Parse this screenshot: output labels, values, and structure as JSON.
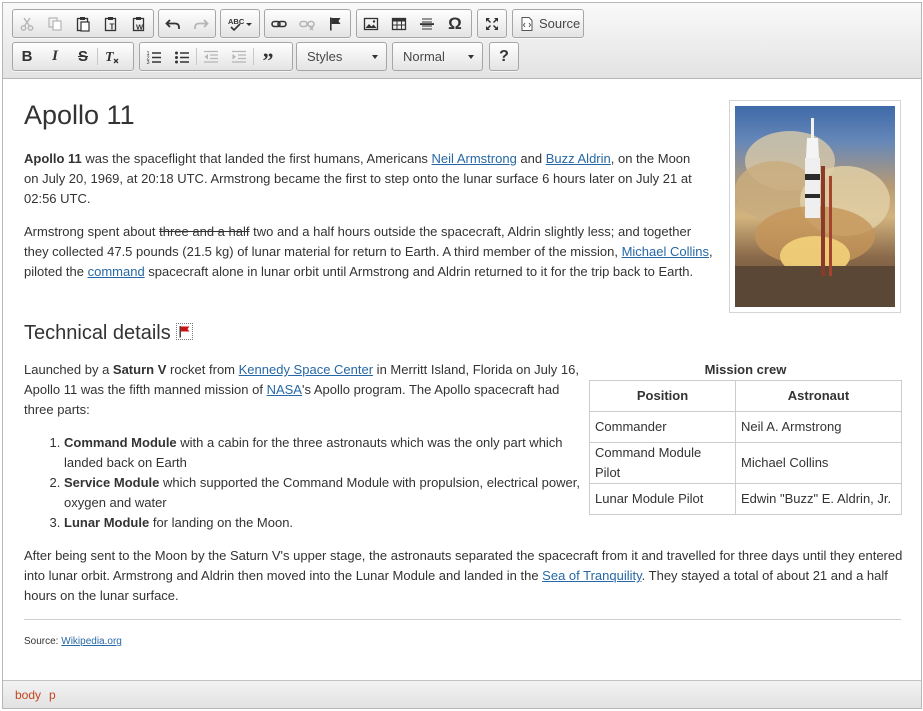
{
  "toolbar": {
    "row1": {
      "clipboard": [
        "cut-icon",
        "copy-icon",
        "paste-icon",
        "paste-text-icon",
        "paste-word-icon"
      ],
      "undo": [
        "undo-icon",
        "redo-icon"
      ],
      "spell": "spellcheck-icon",
      "links": [
        "link-icon",
        "unlink-icon",
        "anchor-icon"
      ],
      "insert": [
        "image-icon",
        "table-icon",
        "horizontal-rule-icon",
        "special-char-icon"
      ],
      "maximize": "maximize-icon",
      "source_label": "Source"
    },
    "row2": {
      "basic": [
        "bold-icon",
        "italic-icon",
        "strike-icon",
        "remove-format-icon"
      ],
      "lists": [
        "numbered-list-icon",
        "bulleted-list-icon",
        "outdent-icon",
        "indent-icon",
        "blockquote-icon"
      ],
      "styles_combo": "Styles",
      "format_combo": "Normal",
      "help_label": "?"
    }
  },
  "content": {
    "title": "Apollo 11",
    "p1": {
      "b1": "Apollo 11",
      "t1": " was the spaceflight that landed the first humans, Americans ",
      "l1": "Neil Armstrong",
      "t2": " and ",
      "l2": "Buzz Aldrin",
      "t3": ", on the Moon on July 20, 1969, at 20:18 UTC. Armstrong became the first to step onto the lunar surface 6 hours later on July 21 at 02:56 UTC."
    },
    "p2": {
      "t1": "Armstrong spent about ",
      "strike": "three and a half",
      "t2": " two and a half hours outside the spacecraft, Aldrin slightly less; and together they collected 47.5 pounds (21.5 kg) of lunar material for return to Earth. A third member of the mission, ",
      "l1": "Michael Collins",
      "t3": ", piloted the ",
      "l2": "command",
      "t4": " spacecraft alone in lunar orbit until Armstrong and Aldrin returned to it for the trip back to Earth."
    },
    "subtitle": "Technical details",
    "p3": {
      "t1": "Launched by a ",
      "b1": "Saturn V",
      "t2": " rocket from ",
      "l1": "Kennedy Space Center",
      "t3": " in Merritt Island, Florida on July 16, Apollo 11 was the fifth manned mission of ",
      "l2": "NASA",
      "t4": "'s Apollo program. The Apollo spacecraft had three parts:"
    },
    "parts": [
      {
        "b": "Command Module",
        "t": " with a cabin for the three astronauts which was the only part which landed back on Earth"
      },
      {
        "b": "Service Module",
        "t": " which supported the Command Module with propulsion, electrical power, oxygen and water"
      },
      {
        "b": "Lunar Module",
        "t": " for landing on the Moon."
      }
    ],
    "p4": {
      "t1": "After being sent to the Moon by the Saturn V's upper stage, the astronauts separated the spacecraft from it and travelled for three days until they entered into lunar orbit. Armstrong and Aldrin then moved into the Lunar Module and landed in the ",
      "l1": "Sea of Tranquility",
      "t2": ". They stayed a total of about 21 and a half hours on the lunar surface."
    },
    "crew": {
      "caption": "Mission crew",
      "headers": [
        "Position",
        "Astronaut"
      ],
      "rows": [
        [
          "Commander",
          "Neil A. Armstrong"
        ],
        [
          "Command Module Pilot",
          "Michael Collins"
        ],
        [
          "Lunar Module Pilot",
          "Edwin \"Buzz\" E. Aldrin, Jr."
        ]
      ]
    },
    "source": {
      "label": "Source: ",
      "link": "Wikipedia.org"
    }
  },
  "statusbar": {
    "path": [
      "body",
      "p"
    ]
  },
  "colors": {
    "link": "#2668a6",
    "status_path": "#c5451e",
    "flag": "#cc1111"
  }
}
